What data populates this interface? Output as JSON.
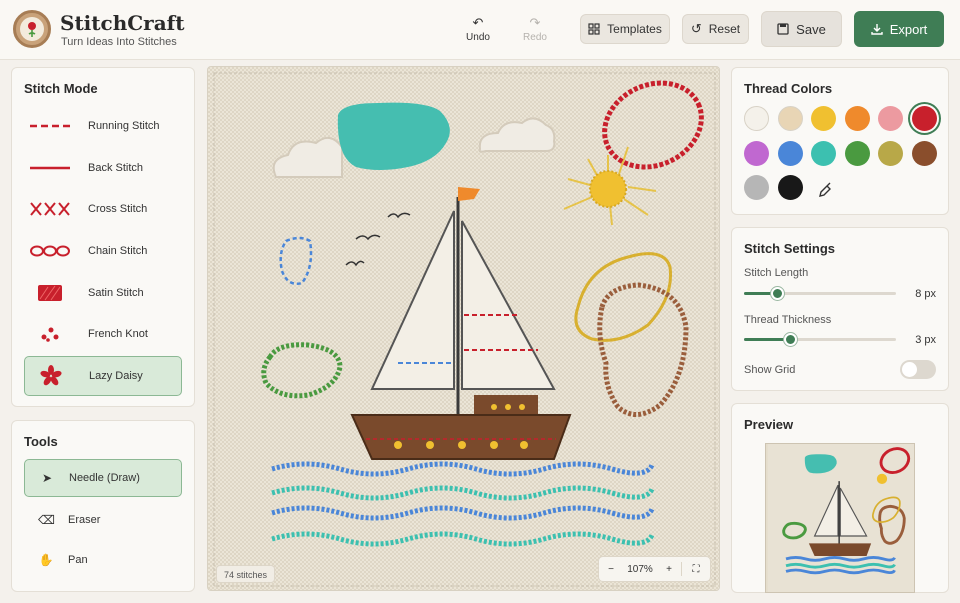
{
  "header": {
    "title": "StitchCraft",
    "subtitle": "Turn Ideas Into Stitches",
    "undo_label": "Undo",
    "redo_label": "Redo",
    "templates_label": "Templates",
    "reset_label": "Reset",
    "save_label": "Save",
    "export_label": "Export"
  },
  "stitch_mode": {
    "title": "Stitch Mode",
    "items": [
      {
        "label": "Running Stitch",
        "icon": "running-stitch-icon"
      },
      {
        "label": "Back Stitch",
        "icon": "back-stitch-icon"
      },
      {
        "label": "Cross Stitch",
        "icon": "cross-stitch-icon"
      },
      {
        "label": "Chain Stitch",
        "icon": "chain-stitch-icon"
      },
      {
        "label": "Satin Stitch",
        "icon": "satin-stitch-icon"
      },
      {
        "label": "French Knot",
        "icon": "french-knot-icon"
      },
      {
        "label": "Lazy Daisy",
        "icon": "lazy-daisy-icon",
        "active": true
      }
    ]
  },
  "tools": {
    "title": "Tools",
    "items": [
      {
        "label": "Needle (Draw)",
        "icon": "cursor-icon",
        "active": true
      },
      {
        "label": "Eraser",
        "icon": "eraser-icon"
      },
      {
        "label": "Pan",
        "icon": "hand-icon"
      }
    ]
  },
  "canvas": {
    "stitch_count": "74 stitches",
    "zoom": "107%"
  },
  "thread_colors": {
    "title": "Thread Colors",
    "colors": [
      "#f4f1ea",
      "#e8d5b5",
      "#f0c030",
      "#ef8a2c",
      "#ec9aa0",
      "#c8202c",
      "#c068d0",
      "#4a86d8",
      "#3cc0b0",
      "#4a9a40",
      "#b8a848",
      "#8a4e2c",
      "#b6b6b6",
      "#181818"
    ],
    "selected": "#c8202c",
    "picker_icon": "eyedropper-icon"
  },
  "settings": {
    "title": "Stitch Settings",
    "stitch_length_label": "Stitch Length",
    "stitch_length_value": "8 px",
    "stitch_length_fraction": 0.22,
    "thread_thickness_label": "Thread Thickness",
    "thread_thickness_value": "3 px",
    "thread_thickness_fraction": 0.3,
    "show_grid_label": "Show Grid",
    "show_grid": false
  },
  "preview": {
    "title": "Preview"
  }
}
